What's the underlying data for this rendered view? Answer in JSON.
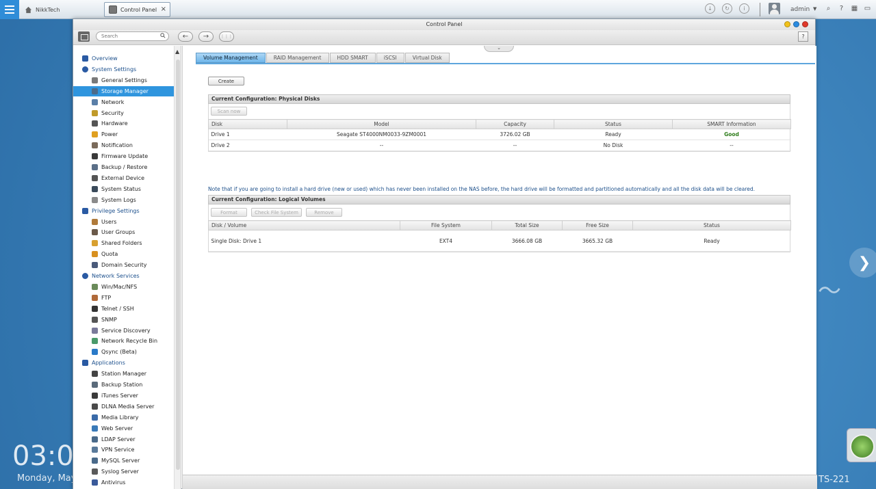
{
  "desktop": {
    "home_tab_label": "NikkTech",
    "app_tab_label": "Control Panel",
    "close_glyph": "×",
    "user_name": "admin",
    "clock": "03:0",
    "date": "Monday, May",
    "model": "TS-221",
    "next_glyph": "❯",
    "swoosh_glyph": "〜",
    "sys_glyphs": [
      "↓",
      "↻",
      "i"
    ],
    "right_glyphs": [
      "⌕",
      "?",
      "▦",
      "▭"
    ]
  },
  "window": {
    "title": "Control Panel",
    "search_placeholder": "Search",
    "back_glyph": "←",
    "forward_glyph": "→",
    "grid_glyph": "⋮⋮⋮",
    "help_glyph": "?",
    "collapse_glyph": "⌄",
    "scroll_up_glyph": "▲"
  },
  "sidebar": {
    "items": [
      {
        "label": "Overview",
        "type": "cat",
        "icon": "overview-icon",
        "color": "#2a5aa3"
      },
      {
        "label": "System Settings",
        "type": "cat",
        "icon": "gear-icon",
        "color": "#2a5aa3"
      },
      {
        "label": "General Settings",
        "type": "sub",
        "icon": "settings-icon",
        "color": "#7a7a7a"
      },
      {
        "label": "Storage Manager",
        "type": "sub",
        "icon": "storage-icon",
        "color": "#4b6b8a",
        "active": true
      },
      {
        "label": "Network",
        "type": "sub",
        "icon": "network-icon",
        "color": "#5a7fa8"
      },
      {
        "label": "Security",
        "type": "sub",
        "icon": "lock-icon",
        "color": "#c09a2a"
      },
      {
        "label": "Hardware",
        "type": "sub",
        "icon": "hardware-icon",
        "color": "#555555"
      },
      {
        "label": "Power",
        "type": "sub",
        "icon": "power-icon",
        "color": "#e0a020"
      },
      {
        "label": "Notification",
        "type": "sub",
        "icon": "notification-icon",
        "color": "#7a6a5a"
      },
      {
        "label": "Firmware Update",
        "type": "sub",
        "icon": "firmware-icon",
        "color": "#3a3a3a"
      },
      {
        "label": "Backup / Restore",
        "type": "sub",
        "icon": "backup-icon",
        "color": "#5b6f88"
      },
      {
        "label": "External Device",
        "type": "sub",
        "icon": "external-device-icon",
        "color": "#555555"
      },
      {
        "label": "System Status",
        "type": "sub",
        "icon": "monitor-icon",
        "color": "#3a4a5a"
      },
      {
        "label": "System Logs",
        "type": "sub",
        "icon": "logs-icon",
        "color": "#8a8a8a"
      },
      {
        "label": "Privilege Settings",
        "type": "cat",
        "icon": "user-icon",
        "color": "#2a5aa3"
      },
      {
        "label": "Users",
        "type": "sub",
        "icon": "user-icon",
        "color": "#b07a3a"
      },
      {
        "label": "User Groups",
        "type": "sub",
        "icon": "user-groups-icon",
        "color": "#6b5a4a"
      },
      {
        "label": "Shared Folders",
        "type": "sub",
        "icon": "folder-icon",
        "color": "#d8a030"
      },
      {
        "label": "Quota",
        "type": "sub",
        "icon": "quota-icon",
        "color": "#d89020"
      },
      {
        "label": "Domain Security",
        "type": "sub",
        "icon": "domain-icon",
        "color": "#4a5a7a"
      },
      {
        "label": "Network Services",
        "type": "cat",
        "icon": "globe-icon",
        "color": "#2a5aa3"
      },
      {
        "label": "Win/Mac/NFS",
        "type": "sub",
        "icon": "win-mac-icon",
        "color": "#6a8a5a"
      },
      {
        "label": "FTP",
        "type": "sub",
        "icon": "ftp-icon",
        "color": "#b06a3a"
      },
      {
        "label": "Telnet / SSH",
        "type": "sub",
        "icon": "terminal-icon",
        "color": "#333333"
      },
      {
        "label": "SNMP",
        "type": "sub",
        "icon": "snmp-icon",
        "color": "#555555"
      },
      {
        "label": "Service Discovery",
        "type": "sub",
        "icon": "discovery-icon",
        "color": "#7a7a9a"
      },
      {
        "label": "Network Recycle Bin",
        "type": "sub",
        "icon": "recycle-bin-icon",
        "color": "#4a9a6a"
      },
      {
        "label": "Qsync (Beta)",
        "type": "sub",
        "icon": "qsync-icon",
        "color": "#2a7ac8"
      },
      {
        "label": "Applications",
        "type": "cat",
        "icon": "applications-icon",
        "color": "#2a5aa3"
      },
      {
        "label": "Station Manager",
        "type": "sub",
        "icon": "station-icon",
        "color": "#444444"
      },
      {
        "label": "Backup Station",
        "type": "sub",
        "icon": "backup-station-icon",
        "color": "#5a6a7a"
      },
      {
        "label": "iTunes Server",
        "type": "sub",
        "icon": "music-icon",
        "color": "#3a3a3a"
      },
      {
        "label": "DLNA Media Server",
        "type": "sub",
        "icon": "media-server-icon",
        "color": "#4a4a4a"
      },
      {
        "label": "Media Library",
        "type": "sub",
        "icon": "media-library-icon",
        "color": "#3a6aa8"
      },
      {
        "label": "Web Server",
        "type": "sub",
        "icon": "web-server-icon",
        "color": "#3a7ab8"
      },
      {
        "label": "LDAP Server",
        "type": "sub",
        "icon": "ldap-icon",
        "color": "#4a6a8a"
      },
      {
        "label": "VPN Service",
        "type": "sub",
        "icon": "vpn-icon",
        "color": "#5a7a9a"
      },
      {
        "label": "MySQL Server",
        "type": "sub",
        "icon": "database-icon",
        "color": "#4a6a8a"
      },
      {
        "label": "Syslog Server",
        "type": "sub",
        "icon": "syslog-icon",
        "color": "#5a5a5a"
      },
      {
        "label": "Antivirus",
        "type": "sub",
        "icon": "antivirus-icon",
        "color": "#3a5a9a"
      }
    ]
  },
  "main": {
    "tabs": [
      {
        "label": "Volume Management",
        "active": true
      },
      {
        "label": "RAID Management"
      },
      {
        "label": "HDD SMART"
      },
      {
        "label": "iSCSI"
      },
      {
        "label": "Virtual Disk"
      }
    ],
    "create_label": "Create",
    "physical": {
      "title": "Current Configuration: Physical Disks",
      "scan_label": "Scan now",
      "headers": [
        "Disk",
        "Model",
        "Capacity",
        "Status",
        "SMART Information"
      ],
      "rows": [
        [
          "Drive 1",
          "Seagate ST4000NM0033-9ZM0001",
          "3726.02 GB",
          "Ready",
          "Good"
        ],
        [
          "Drive 2",
          "--",
          "--",
          "No Disk",
          "--"
        ]
      ]
    },
    "note": "Note that if you are going to install a hard drive (new or used) which has never been installed on the NAS before, the hard drive will be formatted and partitioned automatically and all the disk data will be cleared.",
    "logical": {
      "title": "Current Configuration: Logical Volumes",
      "format_label": "Format",
      "check_label": "Check File System",
      "remove_label": "Remove",
      "headers": [
        "Disk / Volume",
        "File System",
        "Total Size",
        "Free Size",
        "Status"
      ],
      "rows": [
        [
          "Single Disk: Drive 1",
          "EXT4",
          "3666.08 GB",
          "3665.32 GB",
          "Ready"
        ]
      ]
    }
  }
}
